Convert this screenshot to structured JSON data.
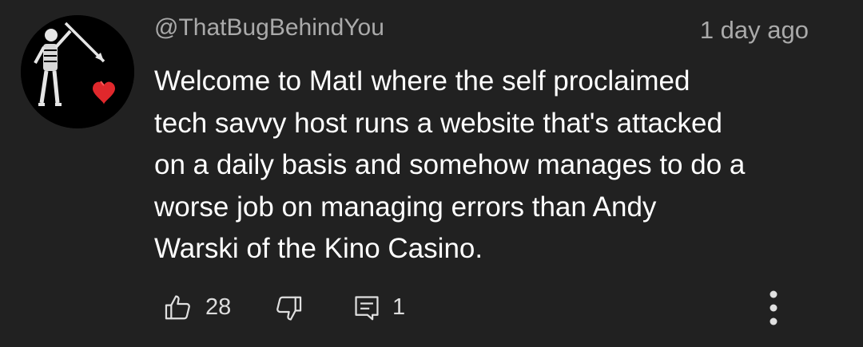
{
  "comment": {
    "author": "@ThatBugBehindYou",
    "timestamp": "1 day ago",
    "text_lines": [
      "Welcome to MatI where the self proclaimed",
      "tech savvy host runs a website that's attacked",
      "on a daily basis and somehow manages to do a",
      "worse job on managing errors than Andy",
      "Warski of the Kino Casino."
    ],
    "avatar_icon": "skeleton-heart-flag-avatar",
    "like_count": "28",
    "reply_count": "1"
  },
  "icons": {
    "like": "thumbs-up-icon",
    "dislike": "thumbs-down-icon",
    "reply": "comment-icon",
    "more": "more-vertical-icon"
  },
  "colors": {
    "background": "#212121",
    "text": "#ffffff",
    "secondary_text": "#aaaaaa",
    "heart": "#e0282c"
  }
}
